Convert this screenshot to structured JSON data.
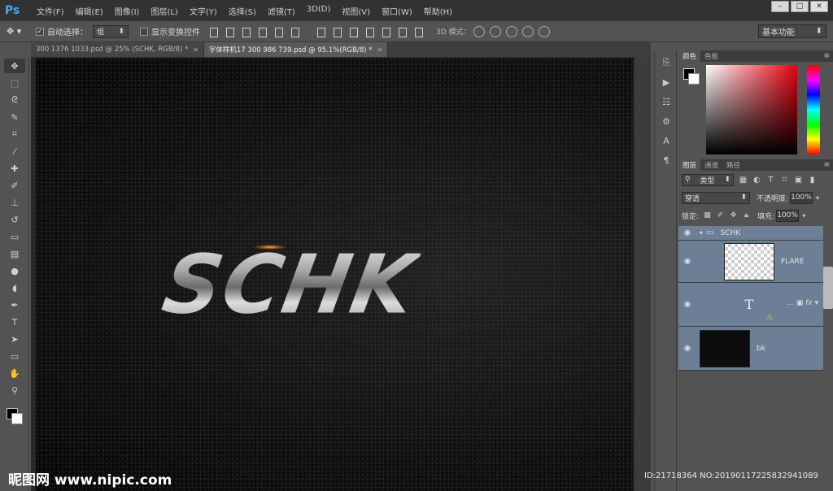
{
  "app": {
    "logo": "Ps"
  },
  "menu": [
    "文件(F)",
    "编辑(E)",
    "图像(I)",
    "图层(L)",
    "文字(Y)",
    "选择(S)",
    "滤镜(T)",
    "3D(D)",
    "视图(V)",
    "窗口(W)",
    "帮助(H)"
  ],
  "window_controls": {
    "minimize": "–",
    "maximize": "□",
    "close": "✕"
  },
  "options": {
    "auto_select_label": "自动选择：",
    "auto_select_checked": true,
    "auto_select_value": "组",
    "show_transform_label": "显示变换控件",
    "mode_3d_label": "3D 模式：",
    "workspace": "基本功能"
  },
  "tabs": [
    {
      "label": "300 1376 1033.psd @ 25% (SCHK, RGB/8) *",
      "active": false
    },
    {
      "label": "字体样机17 300 986 739.psd @ 95.1%(RGB/8) *",
      "active": true
    }
  ],
  "canvas": {
    "text": "SCHK"
  },
  "color_panel": {
    "tabs": [
      "颜色",
      "色板"
    ],
    "fg_color": "#000000",
    "bg_color": "#ffffff"
  },
  "layers_panel": {
    "tabs": [
      "图层",
      "通道",
      "路径"
    ],
    "filter": "类型",
    "blend_mode": "穿透",
    "opacity_label": "不透明度:",
    "opacity": "100%",
    "lock_label": "锁定:",
    "fill_label": "填充:",
    "fill": "100%",
    "layers": [
      {
        "name": "SCHK",
        "type": "group"
      },
      {
        "name": "FLARE",
        "type": "image"
      },
      {
        "name": "",
        "type": "text"
      },
      {
        "name": "bk",
        "type": "image-dark"
      }
    ]
  },
  "watermark": "昵图网 www.nipic.com",
  "image_id": "ID:21718364 NO:20190117225832941089"
}
